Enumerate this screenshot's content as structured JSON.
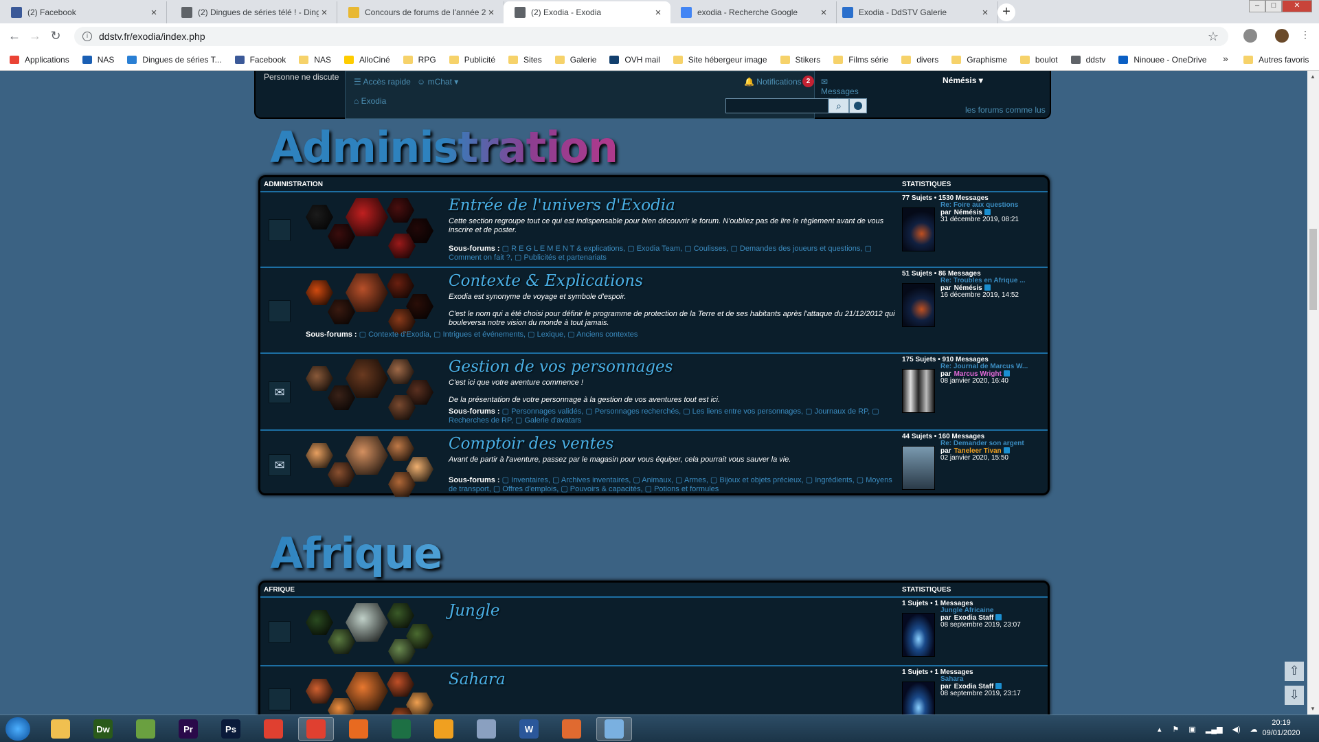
{
  "tabs": [
    {
      "label": "(2) Facebook",
      "icon": "facebook-icon",
      "color": "#3b5998"
    },
    {
      "label": "(2) Dingues de séries télé ! - Ding",
      "icon": "globe-icon",
      "color": "#5f6368"
    },
    {
      "label": "Concours de forums de l'année 2",
      "icon": "smiley-icon",
      "color": "#e8b832"
    },
    {
      "label": "(2) Exodia - Exodia",
      "icon": "globe-icon",
      "color": "#5f6368"
    },
    {
      "label": "exodia - Recherche Google",
      "icon": "google-icon",
      "color": "#4285f4"
    },
    {
      "label": "Exodia - DdSTV Galerie",
      "icon": "gallery-icon",
      "color": "#2a6fcc"
    }
  ],
  "url": "ddstv.fr/exodia/index.php",
  "bookmarks": [
    {
      "label": "Applications",
      "icon": "apps-grid-icon",
      "color": "#ea4335"
    },
    {
      "label": "NAS",
      "icon": "nas-icon",
      "color": "#1a5fb4"
    },
    {
      "label": "Dingues de séries T...",
      "icon": "tv-icon",
      "color": "#2a7fd4"
    },
    {
      "label": "Facebook",
      "icon": "facebook-icon",
      "color": "#3b5998"
    },
    {
      "label": "NAS",
      "icon": "folder-icon",
      "color": "#f6d26a"
    },
    {
      "label": "AlloCiné",
      "icon": "allocine-icon",
      "color": "#fecc00"
    },
    {
      "label": "RPG",
      "icon": "folder-icon",
      "color": "#f6d26a"
    },
    {
      "label": "Publicité",
      "icon": "folder-icon",
      "color": "#f6d26a"
    },
    {
      "label": "Sites",
      "icon": "folder-icon",
      "color": "#f6d26a"
    },
    {
      "label": "Galerie",
      "icon": "folder-icon",
      "color": "#f6d26a"
    },
    {
      "label": "OVH mail",
      "icon": "ovh-icon",
      "color": "#123f6d"
    },
    {
      "label": "Site hébergeur image",
      "icon": "folder-icon",
      "color": "#f6d26a"
    },
    {
      "label": "Stikers",
      "icon": "folder-icon",
      "color": "#f6d26a"
    },
    {
      "label": "Films série",
      "icon": "folder-icon",
      "color": "#f6d26a"
    },
    {
      "label": "divers",
      "icon": "folder-icon",
      "color": "#f6d26a"
    },
    {
      "label": "Graphisme",
      "icon": "folder-icon",
      "color": "#f6d26a"
    },
    {
      "label": "boulot",
      "icon": "folder-icon",
      "color": "#f6d26a"
    },
    {
      "label": "ddstv",
      "icon": "globe-icon",
      "color": "#5f6368"
    },
    {
      "label": "Ninouee - OneDrive",
      "icon": "onedrive-icon",
      "color": "#0a5fc4"
    }
  ],
  "bookmarks_other": "Autres favoris",
  "forum_nav": {
    "nobody": "Personne ne discute",
    "quick_access": "Accès rapide",
    "mchat": "mChat",
    "notifications": "Notifications",
    "notif_count": "2",
    "messages": "Messages privés",
    "username": "Némésis",
    "home": "Exodia",
    "mark_read": "les forums comme lus"
  },
  "categories": [
    {
      "title": "Administration",
      "header": "ADMINISTRATION",
      "stats_header": "STATISTIQUES",
      "forums": [
        {
          "title": "Entrée de l'univers d'Exodia",
          "desc": [
            "Cette section regroupe tout ce qui est indispensable pour bien découvrir le forum. N'oubliez pas de lire le règlement avant de vous inscrire et de poster."
          ],
          "subforums_label": "Sous-forums :",
          "subforums": [
            "R E G L E M E N T & explications",
            "Exodia Team",
            "Coulisses",
            "Demandes des joueurs et questions",
            "Comment on fait ?",
            "Publicités et partenariats"
          ],
          "counts": "77 Sujets • 1530 Messages",
          "last_post": "Re: Foire aux questions",
          "by": "par",
          "author": "Némésis",
          "author_color": "#ffffff",
          "date": "31 décembre 2019, 08:21",
          "status_icon": "",
          "hex_colors": [
            "#1b1b1b",
            "#3a0d0d",
            "#c02020",
            "#4a0f0f",
            "#220808",
            "#9a1a1a"
          ]
        },
        {
          "title": "Contexte & Explications",
          "desc": [
            "Exodia est synonyme de voyage et symbole d'espoir.",
            "C'est le nom qui a été choisi pour définir le programme de protection de la Terre et de ses habitants après l'attaque du 21/12/2012 qui bouleversa notre vision du monde à tout jamais."
          ],
          "subforums_label": "Sous-forums :",
          "subforums": [
            "Contexte d'Exodia",
            "Intrigues et événements",
            "Lexique",
            "Anciens contextes"
          ],
          "counts": "51 Sujets • 86 Messages",
          "last_post": "Re: Troubles en Afrique ...",
          "by": "par",
          "author": "Némésis",
          "author_color": "#ffffff",
          "date": "16 décembre 2019, 14:52",
          "status_icon": "",
          "hex_colors": [
            "#d04a10",
            "#3a1a10",
            "#b8502a",
            "#6a2010",
            "#2a0e08",
            "#8a3a1a"
          ]
        },
        {
          "title": "Gestion de vos personnages",
          "desc": [
            "C'est ici que votre aventure commence !",
            "De la présentation de votre personnage à la gestion de vos aventures tout est ici."
          ],
          "subforums_label": "Sous-forums :",
          "subforums": [
            "Personnages validés",
            "Personnages recherchés",
            "Les liens entre vos personnages",
            "Journaux de RP",
            "Recherches de RP",
            "Galerie d'avatars"
          ],
          "counts": "175 Sujets • 910 Messages",
          "last_post": "Re: Journal de Marcus W...",
          "by": "par",
          "author": "Marcus Wright",
          "author_color": "#e26ad8",
          "date": "08 janvier 2020, 16:40",
          "status_icon": "✉",
          "hex_colors": [
            "#8a5a3a",
            "#3a2218",
            "#6a3a20",
            "#a06a48",
            "#5a3020",
            "#7a4a30"
          ]
        },
        {
          "title": "Comptoir des ventes",
          "desc": [
            "Avant de partir à l'aventure, passez par le magasin pour vous équiper, cela pourrait vous sauver la vie."
          ],
          "subforums_label": "Sous-forums :",
          "subforums": [
            "Inventaires",
            "Archives inventaires",
            "Animaux",
            "Armes",
            "Bijoux et objets précieux",
            "Ingrédients",
            "Moyens de transport",
            "Offres d'emplois",
            "Pouvoirs & capacités",
            "Potions et formules"
          ],
          "counts": "44 Sujets • 160 Messages",
          "last_post": "Re: Demander son argent",
          "by": "par",
          "author": "Taneleer Tivan",
          "author_color": "#f0a020",
          "date": "02 janvier 2020, 15:50",
          "status_icon": "✉",
          "hex_colors": [
            "#e8a060",
            "#8a5030",
            "#d49060",
            "#c07a48",
            "#f0b070",
            "#b06838"
          ]
        }
      ]
    },
    {
      "title": "Afrique",
      "header": "AFRIQUE",
      "stats_header": "STATISTIQUES",
      "forums": [
        {
          "title": "Jungle",
          "desc": [],
          "subforums_label": "",
          "subforums": [],
          "counts": "1 Sujets • 1 Messages",
          "last_post": "Jungle Africaine",
          "by": "par",
          "author": "Exodia Staff",
          "author_color": "#ffffff",
          "date": "08 septembre 2019, 23:07",
          "status_icon": "",
          "hex_colors": [
            "#2a4a20",
            "#5a7a40",
            "#c0d0c8",
            "#3a5a28",
            "#4a6a30",
            "#6a8a50"
          ]
        },
        {
          "title": "Sahara",
          "desc": [],
          "subforums_label": "",
          "subforums": [],
          "counts": "1 Sujets • 1 Messages",
          "last_post": "Sahara",
          "by": "par",
          "author": "Exodia Staff",
          "author_color": "#ffffff",
          "date": "08 septembre 2019, 23:17",
          "status_icon": "",
          "hex_colors": [
            "#d06030",
            "#f09040",
            "#e87830",
            "#c05028",
            "#f0a050",
            "#a84a20"
          ]
        }
      ]
    }
  ],
  "taskbar_apps": [
    {
      "label": "",
      "icon": "explorer-folder-icon",
      "color": "#f0c050"
    },
    {
      "label": "Dw",
      "icon": "dreamweaver-icon",
      "color": "#2a5a1a"
    },
    {
      "label": "",
      "icon": "notepad-icon",
      "color": "#6aa040"
    },
    {
      "label": "Pr",
      "icon": "premiere-icon",
      "color": "#2a0a4a"
    },
    {
      "label": "Ps",
      "icon": "photoshop-icon",
      "color": "#0a1a3a"
    },
    {
      "label": "",
      "icon": "chrome-icon",
      "color": "#e04030"
    },
    {
      "label": "",
      "icon": "chrome-icon",
      "color": "#e04030"
    },
    {
      "label": "",
      "icon": "firefox-icon",
      "color": "#e86a20"
    },
    {
      "label": "",
      "icon": "excel-icon",
      "color": "#1d7044"
    },
    {
      "label": "",
      "icon": "outlook-icon",
      "color": "#f0a020"
    },
    {
      "label": "",
      "icon": "app-icon",
      "color": "#8aa0c0"
    },
    {
      "label": "W",
      "icon": "word-icon",
      "color": "#2b579a"
    },
    {
      "label": "",
      "icon": "hand-icon",
      "color": "#e06a30"
    },
    {
      "label": "",
      "icon": "paint-icon",
      "color": "#7ab0e0"
    }
  ],
  "clock": {
    "time": "20:19",
    "date": "09/01/2020"
  }
}
